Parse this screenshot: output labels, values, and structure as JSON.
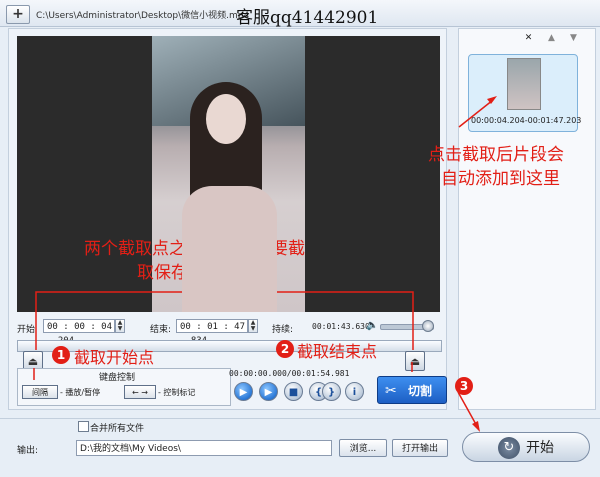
{
  "toolbar": {
    "add_label": "+",
    "file_path": "C:\\Users\\Administrator\\Desktop\\微信小视频.mp4"
  },
  "watermark": "客服qq41442901",
  "time_controls": {
    "start_label": "开始",
    "start_value": "00 : 00 : 04 . 204",
    "end_label": "结束:",
    "end_value": "00 : 01 : 47 . 834",
    "duration_label": "持续:",
    "duration_value": "00:01:43.630",
    "volume_level": 0.9
  },
  "keyboard_panel": {
    "title": "键盘控制",
    "space_key": "间隔",
    "space_desc": "- 播放/暂停",
    "arrow_keys": "← →",
    "arrow_desc": "- 控制标记"
  },
  "playback": {
    "timecode": "00:00:00.000/00:01:54.981"
  },
  "cut_button": "切割",
  "segment": {
    "label": "00:00:04.204-00:01:47.203"
  },
  "output": {
    "merge_label": "合并所有文件",
    "merge_checked": false,
    "output_label": "输出:",
    "output_path": "D:\\我的文档\\My Videos\\",
    "browse_button": "浏览...",
    "open_output_button": "打开输出",
    "start_button": "开始"
  },
  "annotations": {
    "added_here_line1": "点击截取后片段会",
    "added_here_line2": "自动添加到这里",
    "segment_line1": "两个截取点之间的片段是要截",
    "segment_line2": "取保存下来的部分",
    "step1_num": "1",
    "step1_text": "截取开始点",
    "step2_num": "2",
    "step2_text": "截取结束点",
    "step3_num": "3"
  },
  "colors": {
    "annotation_red": "#e21f16",
    "cut_blue": "#1d5fc4"
  }
}
